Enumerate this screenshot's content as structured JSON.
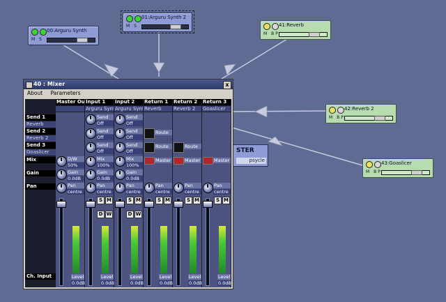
{
  "machines": [
    {
      "id": "gen0",
      "name": "00:Arguru Synth",
      "buttons": "M S"
    },
    {
      "id": "gen1",
      "name": "01:Arguru Synth 2",
      "buttons": "M S"
    },
    {
      "id": "fx41",
      "name": "41:Reverb",
      "buttons": "M BP"
    },
    {
      "id": "fx42",
      "name": "42:Reverb 2",
      "buttons": "M BP"
    },
    {
      "id": "fx43",
      "name": "43:Goaslicer",
      "buttons": "M BP"
    }
  ],
  "master": {
    "title": "STER",
    "sub": "psycle"
  },
  "mixer": {
    "title": "40 : Mixer",
    "close": "x",
    "menu": [
      "About",
      "Parameters"
    ],
    "row_labels": {
      "send1": "Send 1",
      "send1_sub": "Reverb",
      "send2": "Send 2",
      "send2_sub": "Reverb 2",
      "send3": "Send 3",
      "send3_sub": "Goaslicer",
      "mix": "Mix",
      "gain": "Gain",
      "pan": "Pan",
      "ch_input": "Ch. Input"
    },
    "columns": [
      {
        "header": "Master Out",
        "sub": ""
      },
      {
        "header": "Input 1",
        "sub": "Arguru Synt"
      },
      {
        "header": "Input 2",
        "sub": "Arguru Synt"
      },
      {
        "header": "Return 1",
        "sub": "Reverb"
      },
      {
        "header": "Return 2",
        "sub": "Reverb 2"
      },
      {
        "header": "Return 3",
        "sub": "Goaslicer"
      }
    ],
    "send_label": "Send",
    "send_value": "Off",
    "route_label": "Route",
    "master_label": "Master",
    "master_mix": {
      "label": "D/W",
      "value": "50%"
    },
    "input_mix": {
      "label": "Mix",
      "value": "100%"
    },
    "gain": {
      "label": "Gain",
      "value": "0.0dB"
    },
    "pan": {
      "label": "Pan",
      "value": "centre"
    },
    "solo": "S",
    "mute": "M",
    "dry": "D",
    "wet": "W",
    "level": {
      "label": "Level",
      "value": "0.0dB"
    }
  }
}
